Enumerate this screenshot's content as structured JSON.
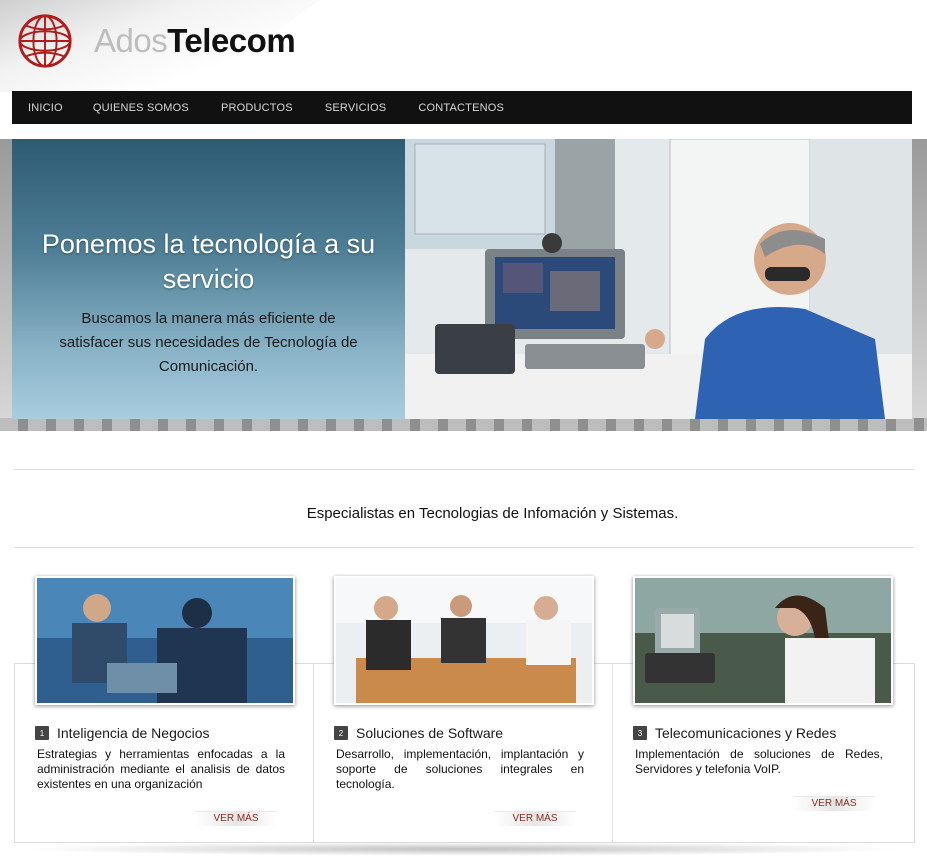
{
  "brand": {
    "name_light": "Ados",
    "name_bold": "Telecom"
  },
  "nav": [
    "INICIO",
    "QUIENES SOMOS",
    "PRODUCTOS",
    "SERVICIOS",
    "CONTACTENOS"
  ],
  "hero": {
    "title": "Ponemos la tecnología a su servicio",
    "subtitle": "Buscamos la manera más eficiente de satisfacer sus necesidades de Tecnología de Comunicación."
  },
  "tagline": "Especialistas en Tecnologias de Infomación y Sistemas.",
  "cards": [
    {
      "num": "1",
      "title": "Inteligencia de Negocios",
      "desc": "Estrategias y herramientas enfocadas a la administración mediante el analisis de datos existentes en una organización",
      "more": "VER MÁS"
    },
    {
      "num": "2",
      "title": "Soluciones de Software",
      "desc": "Desarrollo, implementación, implantación y soporte de soluciones integrales en tecnología.",
      "more": "VER MÁS"
    },
    {
      "num": "3",
      "title": "Telecomunicaciones y Redes",
      "desc": "Implementación de soluciones de Redes, Servidores y telefonia VoIP.",
      "more": "VER MÁS"
    }
  ],
  "colors": {
    "nav_bg": "#111111",
    "link_red": "#8b2a1a",
    "hero_blue_top": "#2c5b73",
    "hero_blue_bottom": "#a9cde0"
  }
}
